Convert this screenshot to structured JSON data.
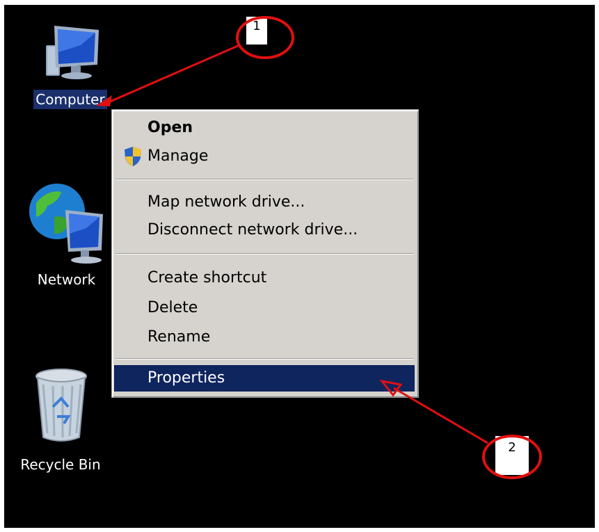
{
  "desktop": {
    "icons": [
      {
        "label": "Computer",
        "icon": "computer-icon",
        "selected": true
      },
      {
        "label": "Network",
        "icon": "network-icon"
      },
      {
        "label": "Recycle Bin",
        "icon": "recycle-bin-icon"
      }
    ]
  },
  "context_menu": {
    "items": [
      {
        "label": "Open",
        "bold": true
      },
      {
        "label": "Manage",
        "icon": "shield-icon"
      },
      {
        "label": "Map network drive..."
      },
      {
        "label": "Disconnect network drive..."
      },
      {
        "label": "Create shortcut"
      },
      {
        "label": "Delete"
      },
      {
        "label": "Rename"
      },
      {
        "label": "Properties",
        "highlighted": true
      }
    ]
  },
  "annotations": [
    {
      "label": "1"
    },
    {
      "label": "2"
    }
  ],
  "colors": {
    "desktop": "#000000",
    "menu_bg": "#d6d3ce",
    "highlight": "#0f255e",
    "annotation": "#e01010"
  }
}
